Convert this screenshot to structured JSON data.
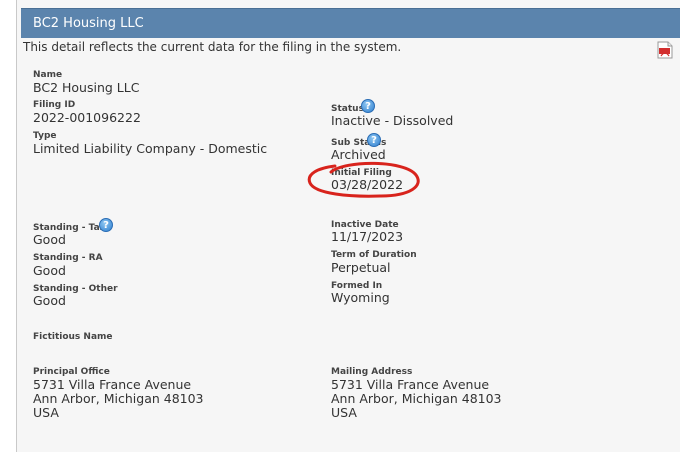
{
  "header": {
    "title": "BC2 Housing LLC"
  },
  "intro": "This detail reflects the current data for the filing in the system.",
  "icons": {
    "help": "question-icon",
    "pdf": "pdf-icon"
  },
  "fields": {
    "name": {
      "label": "Name",
      "value": "BC2 Housing LLC"
    },
    "filing_id": {
      "label": "Filing ID",
      "value": "2022-001096222"
    },
    "type": {
      "label": "Type",
      "value": "Limited Liability Company - Domestic"
    },
    "status": {
      "label": "Status",
      "value": "Inactive - Dissolved"
    },
    "sub_status": {
      "label": "Sub Status",
      "value": "Archived"
    },
    "initial_filing": {
      "label": "Initial Filing",
      "value": "03/28/2022"
    },
    "standing_tax": {
      "label": "Standing - Tax",
      "value": "Good"
    },
    "standing_ra": {
      "label": "Standing - RA",
      "value": "Good"
    },
    "standing_other": {
      "label": "Standing - Other",
      "value": "Good"
    },
    "inactive_date": {
      "label": "Inactive Date",
      "value": "11/17/2023"
    },
    "term_of_duration": {
      "label": "Term of Duration",
      "value": "Perpetual"
    },
    "formed_in": {
      "label": "Formed In",
      "value": "Wyoming"
    },
    "fictitious_name": {
      "label": "Fictitious Name"
    },
    "principal_office": {
      "label": "Principal Office",
      "lines": [
        "5731 Villa France Avenue",
        "Ann Arbor, Michigan 48103",
        "USA"
      ]
    },
    "mailing_address": {
      "label": "Mailing Address",
      "lines": [
        "5731 Villa France Avenue",
        "Ann Arbor, Michigan 48103",
        "USA"
      ]
    }
  },
  "colors": {
    "header": "#5b84ad",
    "annotation": "#d8231c"
  }
}
